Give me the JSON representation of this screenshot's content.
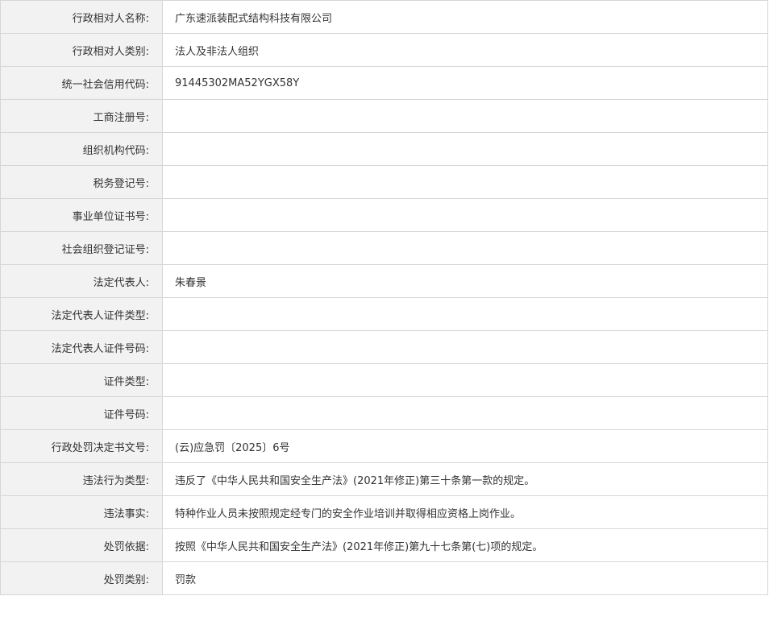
{
  "rows": [
    {
      "label": "行政相对人名称:",
      "value": "广东速派装配式结构科技有限公司"
    },
    {
      "label": "行政相对人类别:",
      "value": "法人及非法人组织"
    },
    {
      "label": "统一社会信用代码:",
      "value": "91445302MA52YGX58Y"
    },
    {
      "label": "工商注册号:",
      "value": ""
    },
    {
      "label": "组织机构代码:",
      "value": ""
    },
    {
      "label": "税务登记号:",
      "value": ""
    },
    {
      "label": "事业单位证书号:",
      "value": ""
    },
    {
      "label": "社会组织登记证号:",
      "value": ""
    },
    {
      "label": "法定代表人:",
      "value": "朱春景"
    },
    {
      "label": "法定代表人证件类型:",
      "value": ""
    },
    {
      "label": "法定代表人证件号码:",
      "value": ""
    },
    {
      "label": "证件类型:",
      "value": ""
    },
    {
      "label": "证件号码:",
      "value": ""
    },
    {
      "label": "行政处罚决定书文号:",
      "value": "(云)应急罚〔2025〕6号"
    },
    {
      "label": "违法行为类型:",
      "value": "违反了《中华人民共和国安全生产法》(2021年修正)第三十条第一款的规定。"
    },
    {
      "label": "违法事实:",
      "value": "特种作业人员未按照规定经专门的安全作业培训并取得相应资格上岗作业。"
    },
    {
      "label": "处罚依据:",
      "value": "按照《中华人民共和国安全生产法》(2021年修正)第九十七条第(七)项的规定。"
    },
    {
      "label": "处罚类别:",
      "value": "罚款"
    }
  ]
}
